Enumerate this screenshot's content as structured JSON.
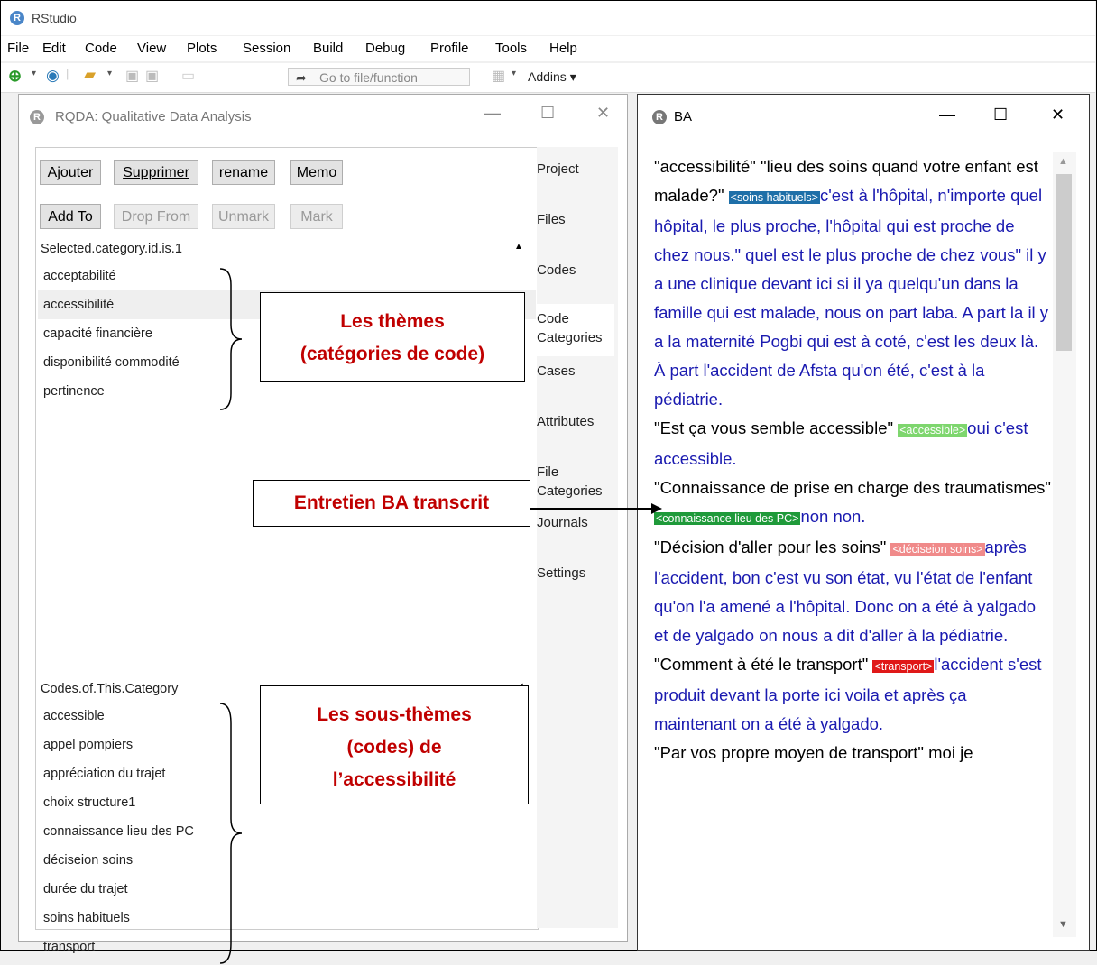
{
  "app": {
    "icon": "R",
    "title": "RStudio"
  },
  "menu": [
    "File",
    "Edit",
    "Code",
    "View",
    "Plots",
    "Session",
    "Build",
    "Debug",
    "Profile",
    "Tools",
    "Help"
  ],
  "toolbar": {
    "goto_placeholder": "Go to file/function",
    "addins": "Addins"
  },
  "rqda": {
    "title": "RQDA: Qualitative Data Analysis",
    "buttons_row1": [
      "Ajouter",
      "Supprimer",
      "rename",
      "Memo"
    ],
    "buttons_row2": [
      "Add To",
      "Drop From",
      "Unmark",
      "Mark"
    ],
    "category_header": "Selected.category.id.is.1",
    "categories": [
      "acceptabilité",
      "accessibilité",
      "capacité financière",
      "disponibilité commodité",
      "pertinence"
    ],
    "codes_header": "Codes.of.This.Category",
    "codes": [
      "accessible",
      "appel pompiers",
      "appréciation du trajet",
      "choix structure1",
      "connaissance lieu des PC",
      "déciseion soins",
      "durée du trajet",
      "soins habituels",
      "transport"
    ],
    "tabs": [
      "Project",
      "Files",
      "Codes",
      "Code Categories",
      "Cases",
      "Attributes",
      "File Categories",
      "Journals",
      "Settings"
    ]
  },
  "ba": {
    "title": "BA",
    "lines": [
      {
        "q": "\"accessibilité\" \"lieu des soins quand votre enfant est malade?\"",
        "tag": "<soins habituels>",
        "tag_bg": "#1e6fa8",
        "tag_fg": "#ffffff",
        "a": "c'est à l'hôpital, n'importe quel hôpital, le plus proche, l'hôpital qui est proche de chez nous.\" quel est le plus proche de chez vous\" il y a une clinique devant ici si il ya quelqu'un dans la famille qui est malade, nous on part laba. A part la il y a la maternité Pogbi qui est à coté, c'est les deux là. À part l'accident de Afsta qu'on été, c'est à la pédiatrie."
      },
      {
        "q": "\"Est ça vous semble accessible\"",
        "tag": "<accessible>",
        "tag_bg": "#7ed66e",
        "tag_fg": "#ffffff",
        "a": "oui c'est accessible."
      },
      {
        "q": "\"Connaissance de prise en charge des traumatismes\"",
        "tag": "<connaissance lieu des PC>",
        "tag_bg": "#1f9a3a",
        "tag_fg": "#ffffff",
        "a": "non non."
      },
      {
        "q": "\"Décision d'aller pour les soins\"",
        "tag": "<déciseion soins>",
        "tag_bg": "#f08a8a",
        "tag_fg": "#ffffff",
        "a": "après l'accident, bon c'est vu son état, vu l'état de l'enfant qu'on l'a amené a l'hôpital. Donc on a été à yalgado et de yalgado on nous a dit d'aller à la pédiatrie."
      },
      {
        "q": "\"Comment à été le transport\"",
        "tag": "<transport>",
        "tag_bg": "#e01818",
        "tag_fg": "#ffffff",
        "a": "l'accident s'est produit devant la porte ici voila et après ça maintenant on a été à yalgado."
      },
      {
        "q": "\"Par vos propre moyen de transport\" moi je",
        "tag": "",
        "tag_bg": "",
        "tag_fg": "",
        "a": ""
      }
    ]
  },
  "annotations": {
    "themes": [
      "Les thèmes",
      "(catégories de code)"
    ],
    "interview": "Entretien BA transcrit",
    "subthemes": [
      "Les sous-thèmes",
      "(codes) de",
      "l’accessibilité"
    ]
  }
}
